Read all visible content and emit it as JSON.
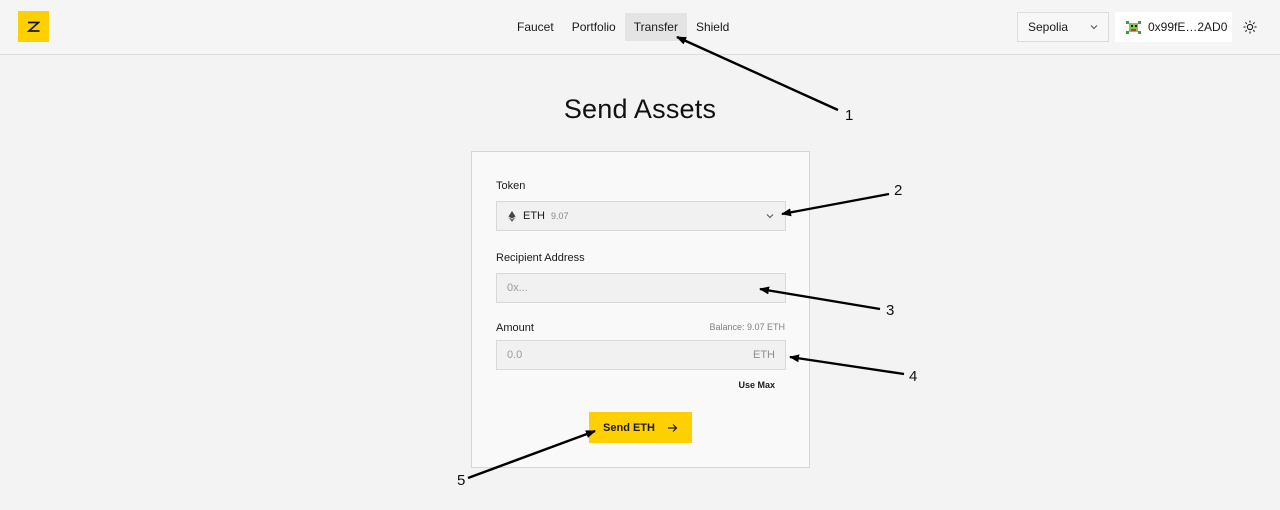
{
  "header": {
    "nav": [
      {
        "label": "Faucet"
      },
      {
        "label": "Portfolio"
      },
      {
        "label": "Transfer"
      },
      {
        "label": "Shield"
      }
    ],
    "network": {
      "label": "Sepolia"
    },
    "wallet": {
      "address": "0x99fE…2AD0"
    }
  },
  "main": {
    "title": "Send Assets",
    "token": {
      "label": "Token",
      "symbol": "ETH",
      "balance": "9.07"
    },
    "recipient": {
      "label": "Recipient Address",
      "placeholder": "0x..."
    },
    "amount": {
      "label": "Amount",
      "balance_text": "Balance: 9.07 ETH",
      "placeholder": "0.0",
      "unit": "ETH",
      "use_max": "Use Max"
    },
    "send_button": "Send ETH"
  },
  "annotations": [
    "1",
    "2",
    "3",
    "4",
    "5"
  ],
  "colors": {
    "accent": "#ffd000",
    "background": "#f3f3f3"
  }
}
